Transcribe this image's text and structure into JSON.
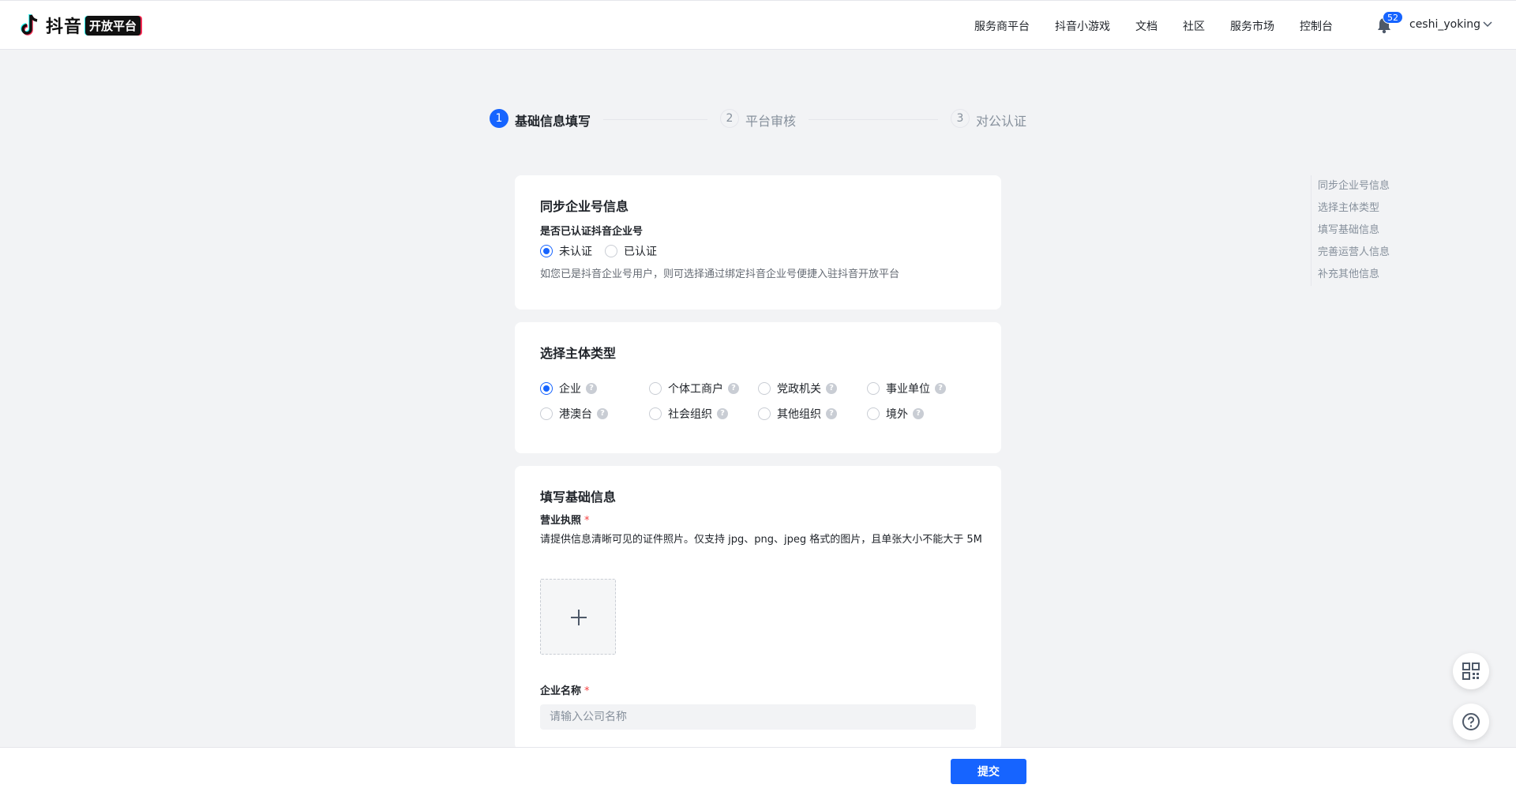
{
  "header": {
    "logo_text": "抖音",
    "logo_badge": "开放平台",
    "nav": [
      "服务商平台",
      "抖音小游戏",
      "文档",
      "社区",
      "服务市场",
      "控制台"
    ],
    "notification_count": "52",
    "username": "ceshi_yoking"
  },
  "steps": [
    {
      "num": "1",
      "label": "基础信息填写",
      "active": true
    },
    {
      "num": "2",
      "label": "平台审核",
      "active": false
    },
    {
      "num": "3",
      "label": "对公认证",
      "active": false
    }
  ],
  "sync_card": {
    "title": "同步企业号信息",
    "question": "是否已认证抖音企业号",
    "options": [
      "未认证",
      "已认证"
    ],
    "selected": "未认证",
    "hint": "如您已是抖音企业号用户，则可选择通过绑定抖音企业号便捷入驻抖音开放平台"
  },
  "entity_card": {
    "title": "选择主体类型",
    "options": [
      "企业",
      "个体工商户",
      "党政机关",
      "事业单位",
      "港澳台",
      "社会组织",
      "其他组织",
      "境外"
    ],
    "selected": "企业"
  },
  "basic_card": {
    "title": "填写基础信息",
    "license_label": "营业执照",
    "license_desc": "请提供信息清晰可见的证件照片。仅支持 jpg、png、jpeg 格式的图片，且单张大小不能大于 5M",
    "company_label": "企业名称",
    "company_placeholder": "请输入公司名称",
    "company_value": ""
  },
  "anchor_nav": [
    "同步企业号信息",
    "选择主体类型",
    "填写基础信息",
    "完善运营人信息",
    "补充其他信息"
  ],
  "footer": {
    "submit_label": "提交"
  },
  "colors": {
    "primary": "#1664ff",
    "required": "#f53f3f",
    "background": "#f2f3f5"
  }
}
